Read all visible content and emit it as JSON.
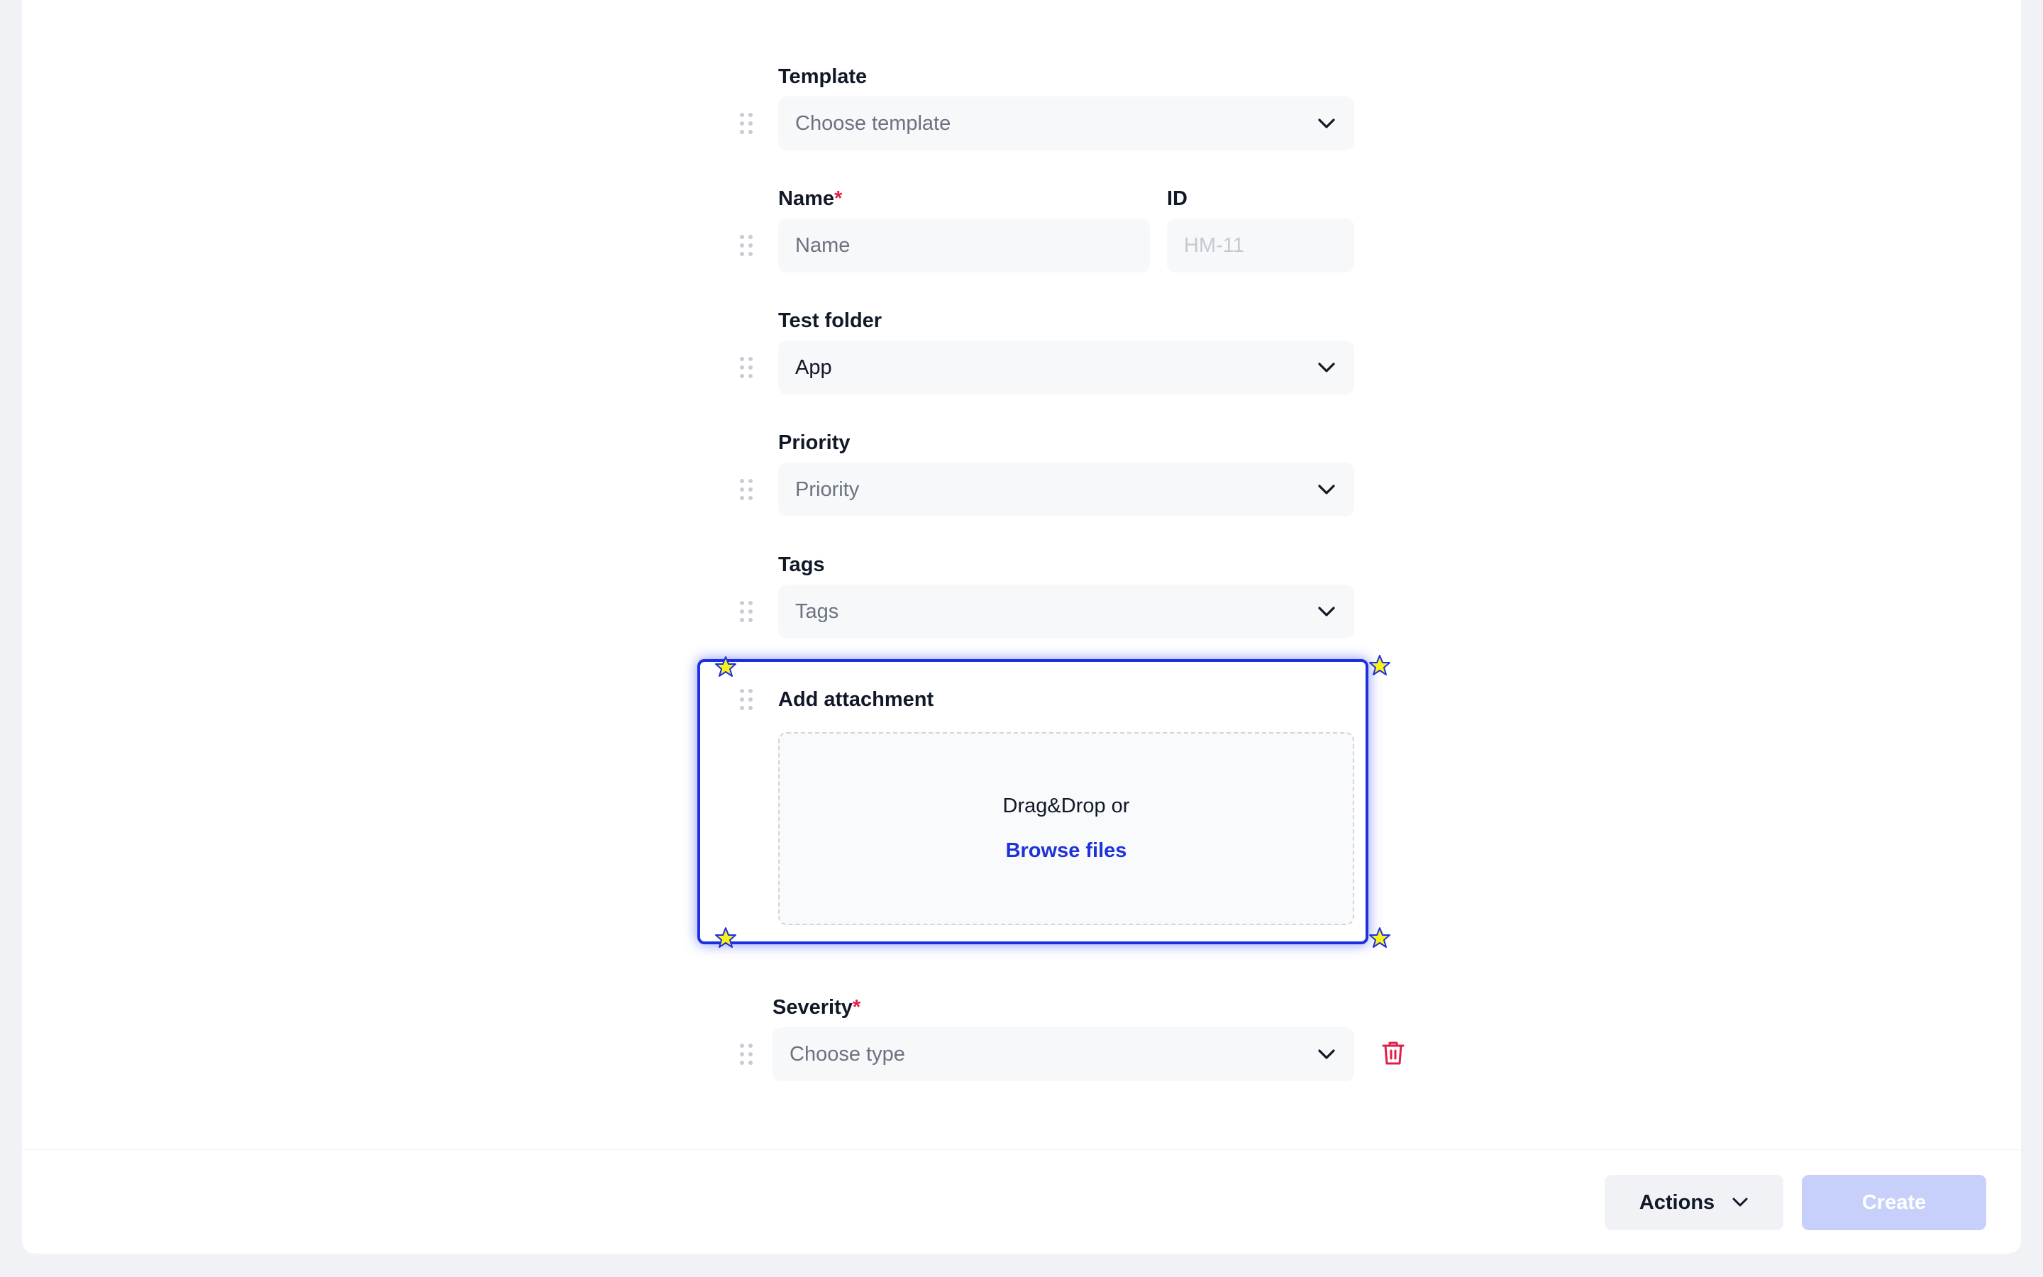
{
  "form": {
    "template": {
      "label": "Template",
      "placeholder": "Choose template"
    },
    "name": {
      "label": "Name",
      "required_mark": "*",
      "placeholder": "Name"
    },
    "id": {
      "label": "ID",
      "value": "HM-11"
    },
    "test_folder": {
      "label": "Test folder",
      "value": "App"
    },
    "priority": {
      "label": "Priority",
      "placeholder": "Priority"
    },
    "tags": {
      "label": "Tags",
      "placeholder": "Tags"
    },
    "attachment": {
      "label": "Add attachment",
      "drop_text": "Drag&Drop or",
      "browse_link": "Browse files"
    },
    "severity": {
      "label": "Severity",
      "required_mark": "*",
      "placeholder": "Choose type"
    }
  },
  "footer": {
    "actions_label": "Actions",
    "create_label": "Create"
  },
  "colors": {
    "accent": "#1d33d8",
    "required": "#e11d48",
    "highlight_border": "#1d2fe0",
    "create_disabled": "#c7d0fb",
    "star": "#f7f318"
  },
  "icons": [
    "drag-handle-icon",
    "chevron-down-icon",
    "trash-icon",
    "star-marker-icon"
  ]
}
